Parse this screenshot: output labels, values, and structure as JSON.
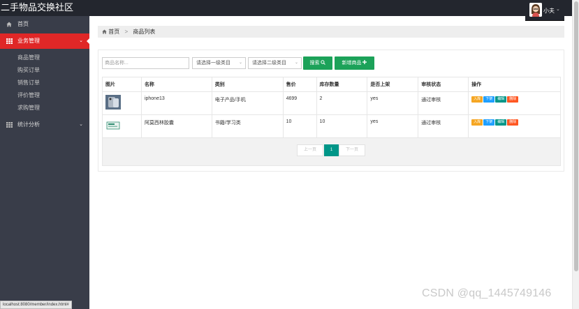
{
  "header": {
    "app_title": "二手物品交换社区",
    "user_name": "小夫",
    "user_caret": "⌄"
  },
  "sidebar": {
    "home": "首页",
    "business": "业务管理",
    "business_items": [
      "商品管理",
      "购买订单",
      "销售订单",
      "评价管理",
      "求购管理"
    ],
    "stats": "统计分析"
  },
  "breadcrumb": {
    "home": "首页",
    "sep": ">",
    "current": "商品列表"
  },
  "toolbar": {
    "name_placeholder": "商品名称...",
    "category1": "请选择一级类目",
    "category2": "请选择二级类目",
    "search_label": "搜索",
    "add_label": "新增商品"
  },
  "table": {
    "columns": [
      "图片",
      "名称",
      "类别",
      "售价",
      "库存数量",
      "是否上架",
      "审核状态",
      "操作"
    ],
    "rows": [
      {
        "name": "iphone13",
        "category": "电子产品/手机",
        "price": "4699",
        "stock": "2",
        "on_shelf": "yes",
        "audit": "通过审核"
      },
      {
        "name": "阿莫西林胶囊",
        "category": "书籍/学习类",
        "price": "10",
        "stock": "10",
        "on_shelf": "yes",
        "audit": "通过审核"
      }
    ],
    "actions": [
      "入库",
      "下架",
      "编辑",
      "删除"
    ]
  },
  "pagination": {
    "prev": "上一页",
    "current": "1",
    "next": "下一页"
  },
  "status_url": "localhost:8080/member/index.html#",
  "watermark": "CSDN @qq_1445749146",
  "colors": {
    "header_bg": "#23262e",
    "sidebar_bg": "#393d49",
    "active_red": "#e02727",
    "green": "#1ca259",
    "teal": "#009688"
  }
}
